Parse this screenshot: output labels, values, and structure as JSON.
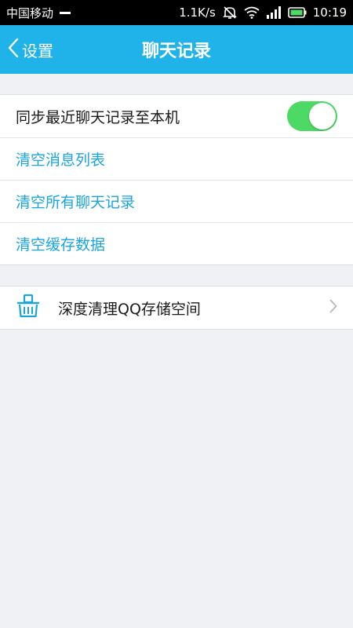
{
  "status_bar": {
    "carrier": "中国移动",
    "speed": "1.1K/s",
    "time": "10:19",
    "icons": [
      "dash-icon",
      "mute-icon",
      "wifi-icon",
      "signal-icon",
      "battery-icon"
    ]
  },
  "header": {
    "back_label": "设置",
    "title": "聊天记录"
  },
  "settings": {
    "sync_label": "同步最近聊天记录至本机",
    "sync_enabled": true,
    "clear_message_list": "清空消息列表",
    "clear_all_chats": "清空所有聊天记录",
    "clear_cache": "清空缓存数据"
  },
  "storage": {
    "deep_clean_label": "深度清理QQ存储空间",
    "icon": "basket-icon"
  },
  "colors": {
    "header_bg": "#1fb3ea",
    "action_text": "#1aa4e0",
    "toggle_on": "#4cd964",
    "page_bg": "#eff1f4"
  }
}
